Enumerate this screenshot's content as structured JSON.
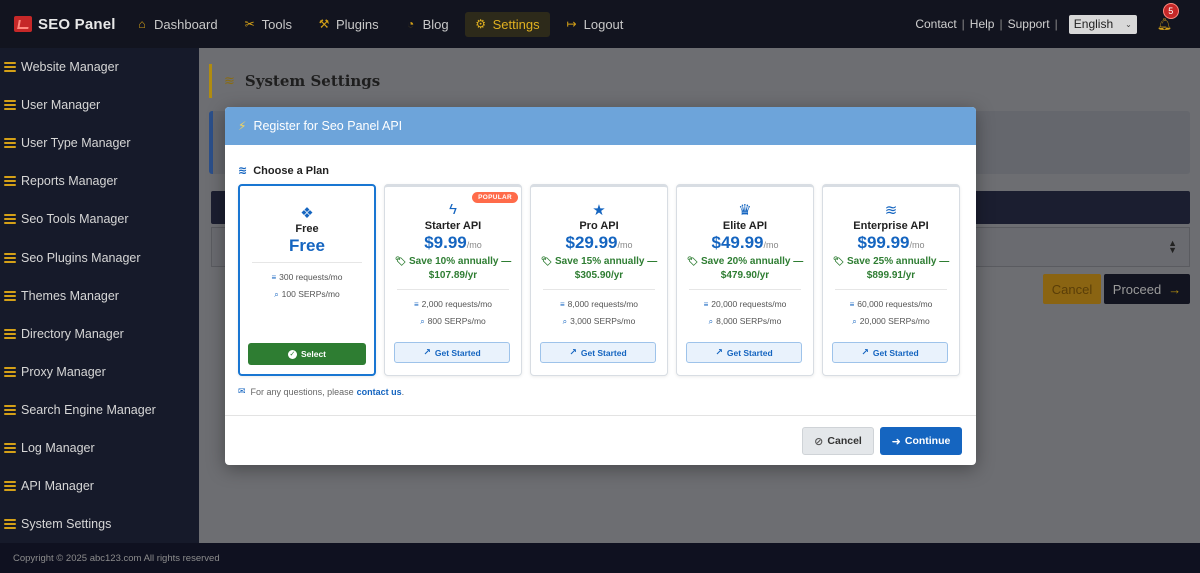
{
  "brand": {
    "name": "SEO Panel"
  },
  "nav": [
    {
      "label": "Dashboard",
      "icon": "home-icon",
      "glyph": "⌂"
    },
    {
      "label": "Tools",
      "icon": "tools-icon",
      "glyph": "✂"
    },
    {
      "label": "Plugins",
      "icon": "wrench-icon",
      "glyph": "⚒"
    },
    {
      "label": "Blog",
      "icon": "rss-icon",
      "glyph": "◔"
    },
    {
      "label": "Settings",
      "icon": "cogs-icon",
      "glyph": "⚙"
    },
    {
      "label": "Logout",
      "icon": "sign-out-icon",
      "glyph": "↦"
    }
  ],
  "toplinks": {
    "contact": "Contact",
    "help": "Help",
    "support": "Support",
    "sep": "|"
  },
  "language": {
    "selected": "English"
  },
  "notifications": {
    "count": "5"
  },
  "sidebar": {
    "items": [
      "Website Manager",
      "User Manager",
      "User Type Manager",
      "Reports Manager",
      "Seo Tools Manager",
      "Seo Plugins Manager",
      "Themes Manager",
      "Directory Manager",
      "Proxy Manager",
      "Search Engine Manager",
      "Log Manager",
      "API Manager",
      "System Settings"
    ]
  },
  "page": {
    "title": "System Settings",
    "cancel": "Cancel",
    "proceed": "Proceed"
  },
  "footer": {
    "copyright": "Copyright © 2025 abc123.com All rights reserved"
  },
  "modal": {
    "title": "Register for Seo Panel API",
    "choose": "Choose a Plan",
    "questions_prefix": "For any questions, please",
    "contact_link": "contact us",
    "questions_suffix": ".",
    "cancel": "Cancel",
    "continue": "Continue",
    "plans": [
      {
        "name": "Free",
        "price": "Free",
        "per": "",
        "save": "",
        "requests": "300 requests/mo",
        "serps": "100 SERPs/mo",
        "button": "Select",
        "icon": "gift-icon",
        "glyph": "❖"
      },
      {
        "name": "Starter API",
        "price": "$9.99",
        "per": "/mo",
        "save": "Save 10% annually — $107.89/yr",
        "requests": "2,000 requests/mo",
        "serps": "800 SERPs/mo",
        "button": "Get Started",
        "icon": "bolt-icon",
        "glyph": "ϟ",
        "badge": "POPULAR"
      },
      {
        "name": "Pro API",
        "price": "$29.99",
        "per": "/mo",
        "save": "Save 15% annually — $305.90/yr",
        "requests": "8,000 requests/mo",
        "serps": "3,000 SERPs/mo",
        "button": "Get Started",
        "icon": "star-icon",
        "glyph": "★"
      },
      {
        "name": "Elite API",
        "price": "$49.99",
        "per": "/mo",
        "save": "Save 20% annually — $479.90/yr",
        "requests": "20,000 requests/mo",
        "serps": "8,000 SERPs/mo",
        "button": "Get Started",
        "icon": "crown-icon",
        "glyph": "♛"
      },
      {
        "name": "Enterprise API",
        "price": "$99.99",
        "per": "/mo",
        "save": "Save 25% annually — $899.91/yr",
        "requests": "60,000 requests/mo",
        "serps": "20,000 SERPs/mo",
        "button": "Get Started",
        "icon": "layers-icon",
        "glyph": "≋"
      }
    ]
  },
  "colors": {
    "accent": "#1565c0",
    "success": "#2e7d32",
    "warning": "#d4a017",
    "modal_header": "#6da4da"
  }
}
